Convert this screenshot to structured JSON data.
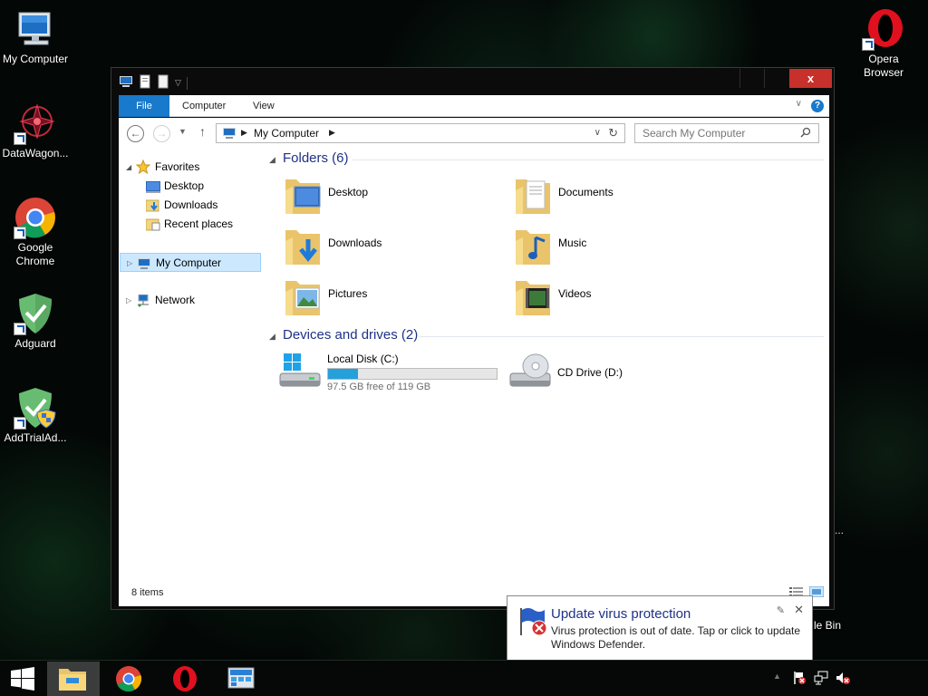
{
  "desktop": {
    "icons": [
      {
        "label": "My Computer",
        "icon": "computer-icon"
      },
      {
        "label": "DataWagon...",
        "icon": "datawagon-icon"
      },
      {
        "label": "Google Chrome",
        "icon": "chrome-icon"
      },
      {
        "label": "Adguard",
        "icon": "adguard-icon"
      },
      {
        "label": "AddTrialAd...",
        "icon": "addtrial-icon"
      }
    ],
    "opera_label": "Opera Browser",
    "recycle_partial": "le Bin",
    "dots_partial": "..."
  },
  "window": {
    "close_glyph": "x",
    "ribbon_tabs": [
      "File",
      "Computer",
      "View"
    ],
    "address_crumb": "My Computer",
    "search_placeholder": "Search My Computer",
    "navpane": {
      "favorites": "Favorites",
      "favorite_items": [
        "Desktop",
        "Downloads",
        "Recent places"
      ],
      "my_computer": "My Computer",
      "network": "Network"
    },
    "groups": {
      "folders": "Folders (6)",
      "devices": "Devices and drives (2)"
    },
    "folders": [
      "Desktop",
      "Documents",
      "Downloads",
      "Music",
      "Pictures",
      "Videos"
    ],
    "drives": {
      "c_label": "Local Disk (C:)",
      "c_free": "97.5 GB free of 119 GB",
      "c_used_fraction": 0.18,
      "d_label": "CD Drive (D:)"
    },
    "status_count": "8 items"
  },
  "notification": {
    "title": "Update virus protection",
    "body": "Virus protection is out of date. Tap or click to update Windows Defender."
  },
  "colors": {
    "accent": "#1979ca",
    "heading": "#1e3287",
    "close": "#c7302b",
    "drive_bar": "#26a0da",
    "selection": "#cce8ff"
  }
}
